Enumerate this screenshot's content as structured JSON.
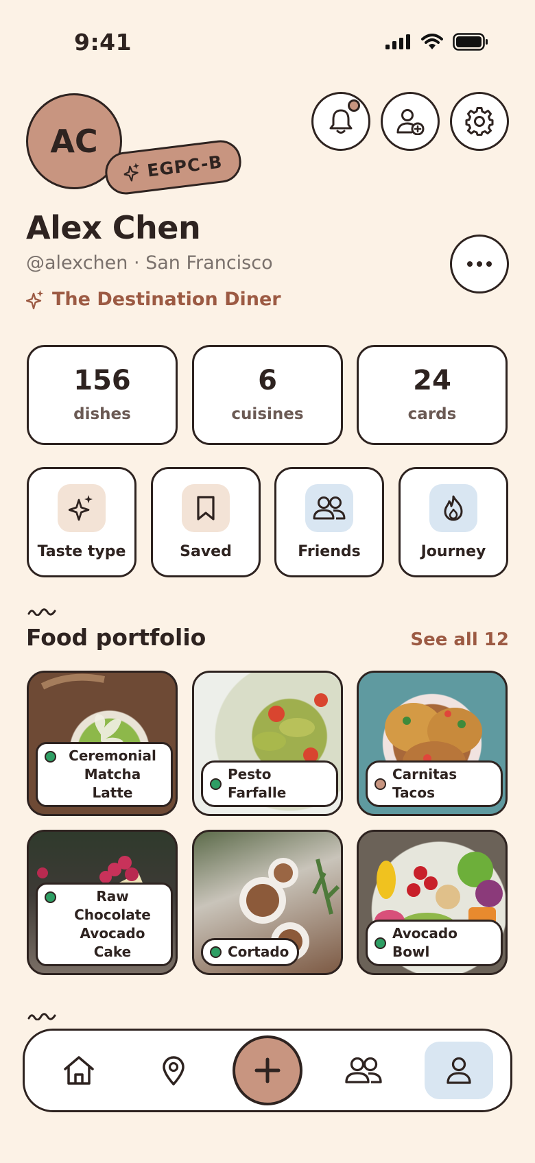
{
  "status_bar": {
    "time": "9:41"
  },
  "profile": {
    "initials": "AC",
    "type_code": "EGPC-B",
    "name": "Alex Chen",
    "handle_location": "@alexchen · San Francisco",
    "taste_type": "The Destination Diner"
  },
  "stats": [
    {
      "value": "156",
      "label": "dishes"
    },
    {
      "value": "6",
      "label": "cuisines"
    },
    {
      "value": "24",
      "label": "cards"
    }
  ],
  "quick_tiles": [
    {
      "label": "Taste type",
      "icon": "sparkle-icon"
    },
    {
      "label": "Saved",
      "icon": "bookmark-icon"
    },
    {
      "label": "Friends",
      "icon": "friends-icon"
    },
    {
      "label": "Journey",
      "icon": "flame-icon"
    }
  ],
  "portfolio": {
    "title": "Food portfolio",
    "see_all": "See all 12",
    "items": [
      {
        "name": "Ceremonial Matcha Latte",
        "line1": "Ceremonial",
        "line2": "Matcha Latte",
        "dot_color": "#2E9E64"
      },
      {
        "name": "Pesto Farfalle",
        "dot_color": "#2E9E64"
      },
      {
        "name": "Carnitas Tacos",
        "dot_color": "#C89580"
      },
      {
        "name": "Raw Chocolate Avocado Cake",
        "line1": "Raw Chocolate",
        "line2": "Avocado Cake",
        "dot_color": "#2E9E64"
      },
      {
        "name": "Cortado",
        "dot_color": "#2E9E64"
      },
      {
        "name": "Avocado Bowl",
        "dot_color": "#2E9E64"
      }
    ]
  },
  "tabbar": {
    "items": [
      "home-icon",
      "map-pin-icon",
      "plus-icon",
      "friends-icon",
      "profile-icon"
    ],
    "active": "profile-icon"
  },
  "colors": {
    "background": "#FCF2E6",
    "accent": "#C89580",
    "ink": "#2E2320",
    "link": "#9C5A43",
    "active_tab": "#D9E6F2"
  }
}
